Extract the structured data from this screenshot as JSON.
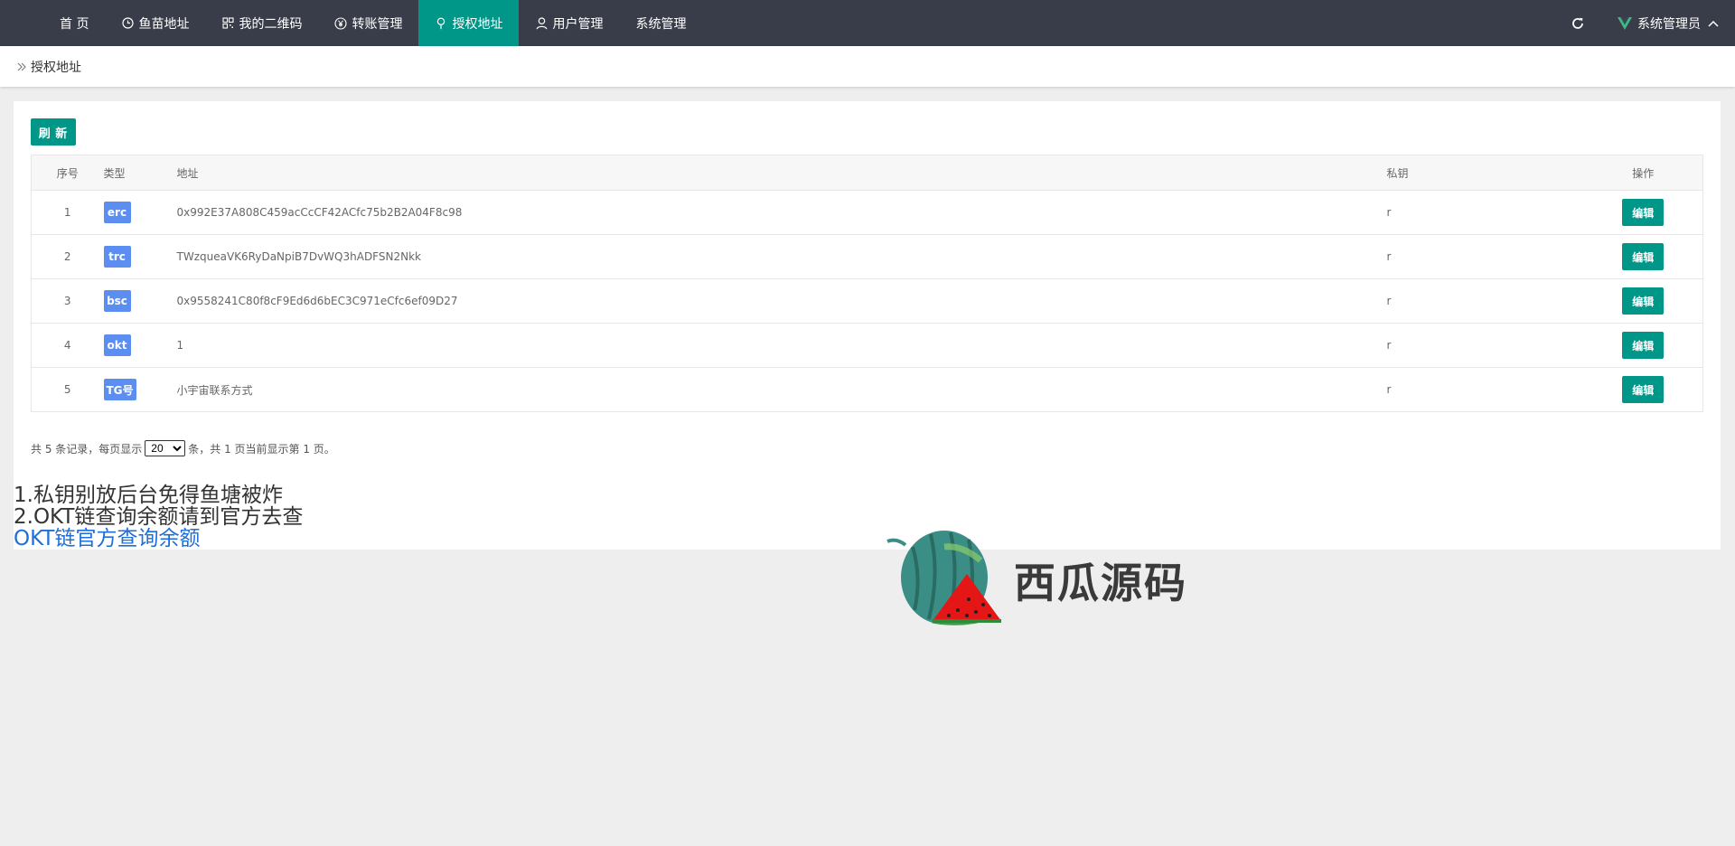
{
  "nav": {
    "items": [
      {
        "label": "首 页",
        "icon": "none",
        "active": false
      },
      {
        "label": "鱼苗地址",
        "icon": "clock-icon",
        "active": false
      },
      {
        "label": "我的二维码",
        "icon": "qrcode-icon",
        "active": false
      },
      {
        "label": "转账管理",
        "icon": "yen-icon",
        "active": false
      },
      {
        "label": "授权地址",
        "icon": "location-pin-icon",
        "active": true
      },
      {
        "label": "用户管理",
        "icon": "user-icon",
        "active": false
      },
      {
        "label": "系统管理",
        "icon": "none",
        "active": false
      }
    ],
    "admin_label": "系统管理员",
    "colors": {
      "bar": "#393d49",
      "active": "#009688",
      "logo": "#41b883"
    }
  },
  "breadcrumb": {
    "label": "授权地址"
  },
  "toolbar": {
    "refresh_label": "刷 新"
  },
  "table": {
    "headers": {
      "index": "序号",
      "type": "类型",
      "address": "地址",
      "private_key": "私钥",
      "action": "操作"
    },
    "rows": [
      {
        "index": "1",
        "type": "erc",
        "address": "0x992E37A808C459acCcCF42ACfc75b2B2A04F8c98",
        "private_key": "r",
        "action": "编辑"
      },
      {
        "index": "2",
        "type": "trc",
        "address": "TWzqueaVK6RyDaNpiB7DvWQ3hADFSN2Nkk",
        "private_key": "r",
        "action": "编辑"
      },
      {
        "index": "3",
        "type": "bsc",
        "address": "0x9558241C80f8cF9Ed6d6bEC3C971eCfc6ef09D27",
        "private_key": "r",
        "action": "编辑"
      },
      {
        "index": "4",
        "type": "okt",
        "address": "1",
        "private_key": "r",
        "action": "编辑"
      },
      {
        "index": "5",
        "type": "TG号",
        "address": "小宇宙联系方式",
        "private_key": "r",
        "action": "编辑"
      }
    ],
    "badge_color": "#5b8ef0"
  },
  "pager": {
    "prefix": "共 5 条记录，每页显示",
    "page_size": "20",
    "suffix": "条，共 1 页当前显示第 1 页。"
  },
  "notes": {
    "line1": "1.私钥别放后台免得鱼塘被炸",
    "line2": "2.OKT链查询余额请到官方去查",
    "link": "OKT链官方查询余额"
  },
  "watermark": {
    "text": "西瓜源码"
  }
}
